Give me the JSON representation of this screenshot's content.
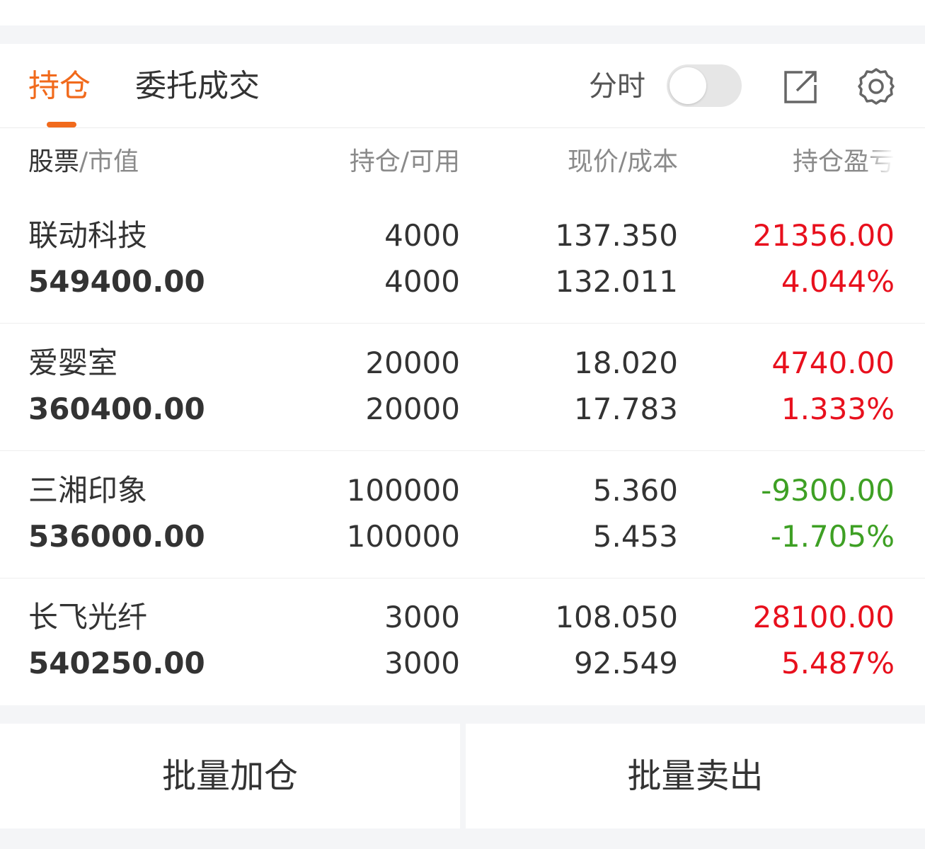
{
  "tabs": {
    "holdings": "持仓",
    "orders": "委托成交"
  },
  "controls": {
    "split_label": "分时"
  },
  "columns": {
    "stock": "股票",
    "market_value": "市值",
    "hold": "持仓",
    "available": "可用",
    "price": "现价",
    "cost": "成本",
    "pnl": "持仓盈亏",
    "separator": "/"
  },
  "rows": [
    {
      "name": "联动科技",
      "market_value": "549400.00",
      "hold": "4000",
      "available": "4000",
      "price": "137.350",
      "cost": "132.011",
      "pnl": "21356.00",
      "pnl_pct": "4.044%"
    },
    {
      "name": "爱婴室",
      "market_value": "360400.00",
      "hold": "20000",
      "available": "20000",
      "price": "18.020",
      "cost": "17.783",
      "pnl": "4740.00",
      "pnl_pct": "1.333%"
    },
    {
      "name": "三湘印象",
      "market_value": "536000.00",
      "hold": "100000",
      "available": "100000",
      "price": "5.360",
      "cost": "5.453",
      "pnl": "-9300.00",
      "pnl_pct": "-1.705%"
    },
    {
      "name": "长飞光纤",
      "market_value": "540250.00",
      "hold": "3000",
      "available": "3000",
      "price": "108.050",
      "cost": "92.549",
      "pnl": "28100.00",
      "pnl_pct": "5.487%"
    }
  ],
  "buttons": {
    "batch_add": "批量加仓",
    "batch_sell": "批量卖出"
  },
  "colors": {
    "accent": "#f16a1c",
    "gain": "#e8101d",
    "loss": "#3ea024"
  },
  "icons": {
    "share": "share-icon",
    "settings": "gear-icon"
  }
}
